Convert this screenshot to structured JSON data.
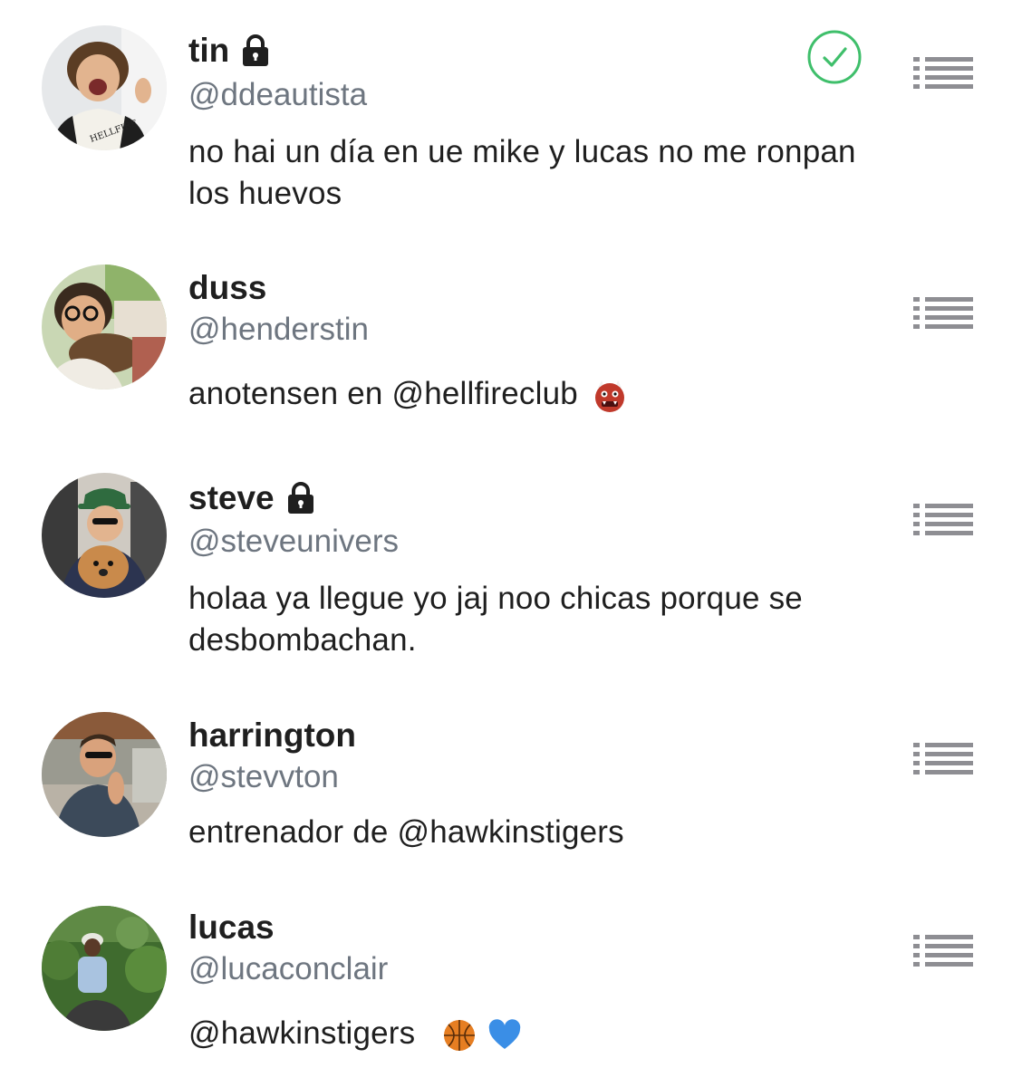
{
  "accounts": [
    {
      "name": "tin",
      "locked": true,
      "handle": "@ddeautista",
      "bio": "no hai un día en ue mike y lucas no me ronpan los huevos",
      "selected": true
    },
    {
      "name": "duss",
      "locked": false,
      "handle": "@henderstin",
      "bio": "anotensen en @hellfireclub",
      "bio_emojis": [
        "ogre-emoji"
      ],
      "selected": false
    },
    {
      "name": "steve",
      "locked": true,
      "handle": "@steveunivers",
      "bio": "holaa ya llegue yo jaj noo chicas porque se desbombachan.",
      "selected": false
    },
    {
      "name": "harrington",
      "locked": false,
      "handle": "@stevvton",
      "bio": "entrenador de @hawkinstigers",
      "selected": false
    },
    {
      "name": "lucas",
      "locked": false,
      "handle": "@lucaconclair",
      "bio": "@hawkinstigers",
      "bio_emojis": [
        "basketball-emoji",
        "blue-heart-emoji"
      ],
      "selected": false
    }
  ],
  "colors": {
    "check_green": "#3fbf6b",
    "menu_gray": "#8e8e93",
    "handle_gray": "#6e7680"
  }
}
